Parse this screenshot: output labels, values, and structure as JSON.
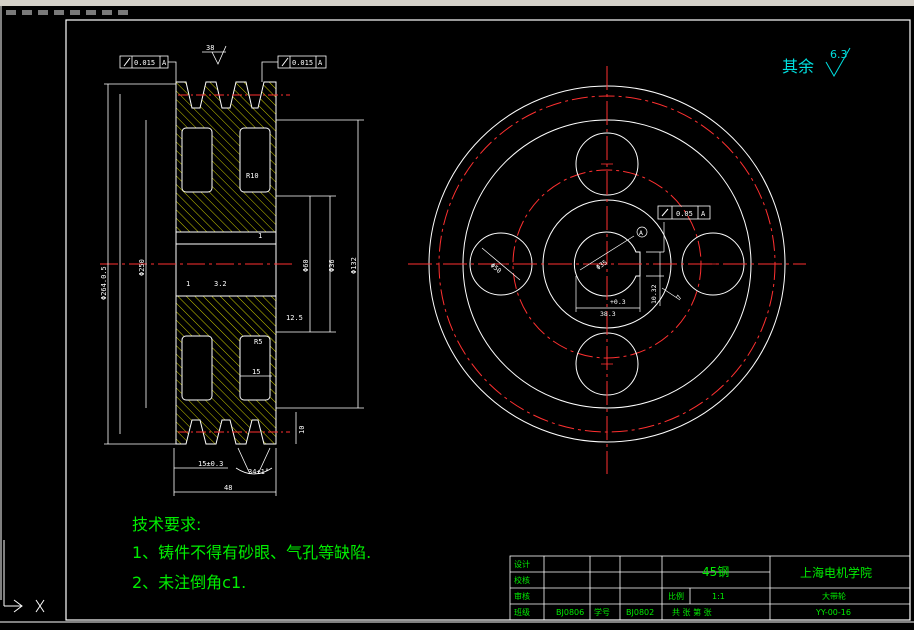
{
  "title_block": {
    "material": "45钢",
    "school": "上海电机学院",
    "part_name": "大带轮",
    "scale_label": "比例",
    "scale": "1:1",
    "drawing_no": "YY-00-16",
    "row_labels": [
      "设计",
      "校核",
      "审核",
      "班级"
    ],
    "class_value": "BJ0806",
    "student_no_label": "学号",
    "student_no_value": "BJ0802",
    "sheet_label": "共 张 第 张"
  },
  "tech_requirements": {
    "heading": "技术要求:",
    "items": [
      "1、铸件不得有砂眼、气孔等缺陷.",
      "2、未注倒角c1."
    ]
  },
  "surface_roughness": {
    "label": "其余",
    "value": "6.3"
  },
  "gdt": {
    "left": {
      "value": "0.015",
      "datum": "A"
    },
    "right": {
      "value": "0.015",
      "datum": "A"
    },
    "front": {
      "value": "0.05",
      "datum": "A"
    }
  },
  "dims": {
    "top_angle": "38",
    "dia_outer": "Φ264.0.5",
    "dia_rim": "Φ250",
    "dia_hub": "Φ60",
    "dia_bore": "Φ36",
    "dia_132": "Φ132",
    "groove_pitch": "15±0.3",
    "groove_edge": "10",
    "width_total": "48",
    "groove_angle": "34±1°",
    "rib": "15",
    "r10": "R10",
    "r5": "R5",
    "roughness_12_5": "12.5",
    "roughness_3_2": "3.2",
    "hole_dia": "Φ50",
    "bore_front": "Φ35",
    "bore_fit": "+0.3",
    "keyway_depth": "38.3",
    "key_width": "10",
    "key_tol": "10.32",
    "r7": "7",
    "r1": "1",
    "datum_a": "A"
  },
  "colors": {
    "line": "#ffffff",
    "center": "#ff3030",
    "dim": "#00e0e0",
    "hatch": "#cccc00",
    "green": "#00ee00",
    "frame": "#ffffff"
  }
}
